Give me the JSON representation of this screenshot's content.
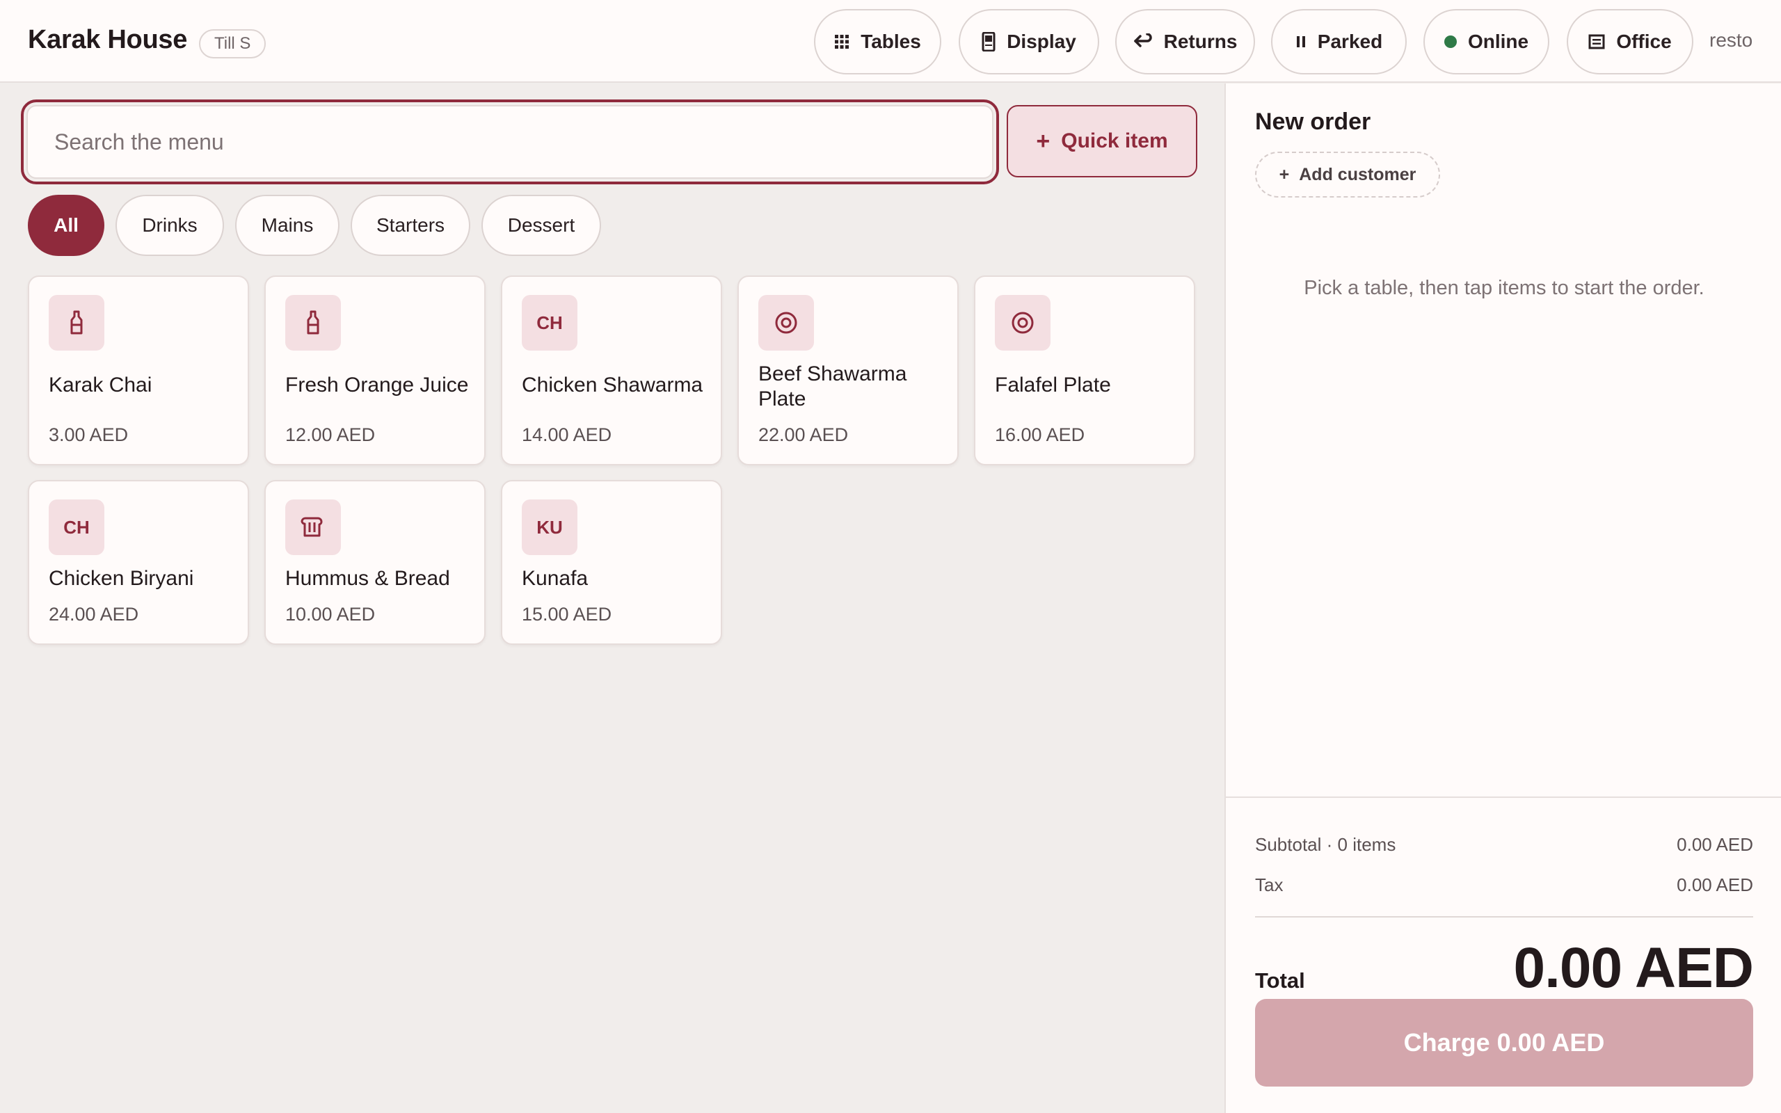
{
  "header": {
    "brand": "Karak House",
    "till": "Till S",
    "buttons": [
      {
        "label": "Tables",
        "icon": "grid-icon"
      },
      {
        "label": "Display",
        "icon": "display-icon"
      },
      {
        "label": "Returns",
        "icon": "return-arrow-icon"
      },
      {
        "label": "Parked",
        "icon": "pause-icon"
      },
      {
        "label": "Online",
        "icon": "status-dot-icon"
      },
      {
        "label": "Office",
        "icon": "office-icon"
      }
    ],
    "user": "resto"
  },
  "search": {
    "placeholder": "Search the menu",
    "value": ""
  },
  "quick_item": {
    "label": "Quick item",
    "icon": "plus-icon"
  },
  "categories": [
    {
      "label": "All",
      "active": true
    },
    {
      "label": "Drinks",
      "active": false
    },
    {
      "label": "Mains",
      "active": false
    },
    {
      "label": "Starters",
      "active": false
    },
    {
      "label": "Dessert",
      "active": false
    }
  ],
  "menu_items": [
    {
      "name": "Karak Chai",
      "price": "3.00 AED",
      "icon": "bottle-icon",
      "badge": ""
    },
    {
      "name": "Fresh Orange Juice",
      "price": "12.00 AED",
      "icon": "bottle-icon",
      "badge": ""
    },
    {
      "name": "Chicken Shawarma",
      "price": "14.00 AED",
      "icon": "initials-icon",
      "badge": "CH"
    },
    {
      "name": "Beef Shawarma Plate",
      "price": "22.00 AED",
      "icon": "plate-icon",
      "badge": ""
    },
    {
      "name": "Falafel Plate",
      "price": "16.00 AED",
      "icon": "plate-icon",
      "badge": ""
    },
    {
      "name": "Chicken Biryani",
      "price": "24.00 AED",
      "icon": "initials-icon",
      "badge": "CH"
    },
    {
      "name": "Hummus & Bread",
      "price": "10.00 AED",
      "icon": "bread-icon",
      "badge": ""
    },
    {
      "name": "Kunafa",
      "price": "15.00 AED",
      "icon": "initials-icon",
      "badge": "KU"
    }
  ],
  "order": {
    "title": "New order",
    "add_customer": "Add customer",
    "empty_hint": "Pick a table, then tap items to start the order.",
    "subtotal_label": "Subtotal · 0 items",
    "subtotal_value": "0.00 AED",
    "tax_label": "Tax",
    "tax_value": "0.00 AED",
    "total_label": "Total",
    "total_value": "0.00 AED",
    "charge_label": "Charge 0.00 AED"
  },
  "colors": {
    "accent": "#8f2a3c",
    "accent_soft": "#f4dfe2",
    "online": "#2f7a47",
    "charge_disabled": "#d4a6ac"
  }
}
